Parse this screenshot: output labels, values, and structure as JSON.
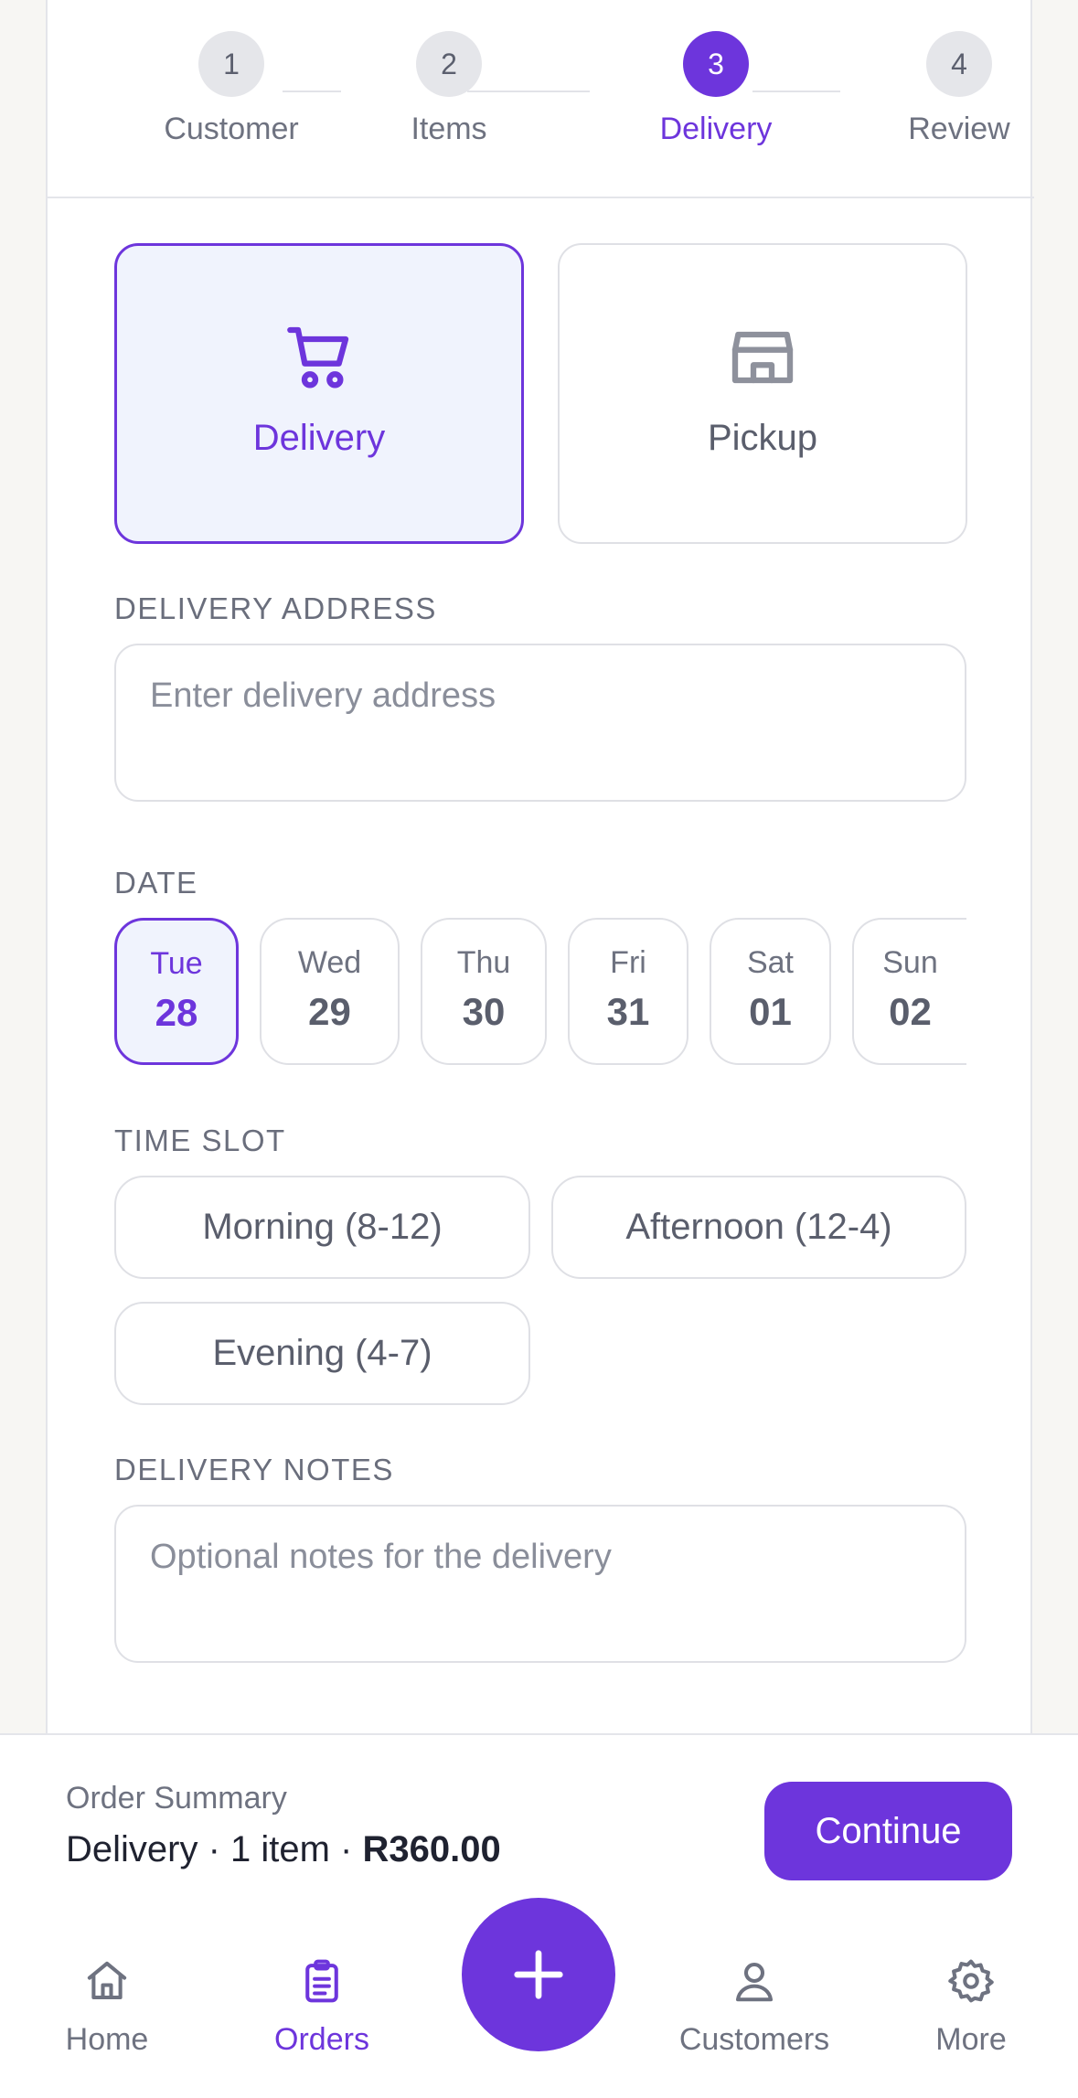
{
  "stepper": {
    "steps": [
      {
        "number": "1",
        "label": "Customer"
      },
      {
        "number": "2",
        "label": "Items"
      },
      {
        "number": "3",
        "label": "Delivery"
      },
      {
        "number": "4",
        "label": "Review"
      }
    ],
    "active_step": 3
  },
  "fulfillment": {
    "options": [
      {
        "label": "Delivery",
        "icon": "cart-icon",
        "selected": true
      },
      {
        "label": "Pickup",
        "icon": "store-icon",
        "selected": false
      }
    ]
  },
  "address": {
    "label": "DELIVERY ADDRESS",
    "placeholder": "Enter delivery address",
    "value": ""
  },
  "date": {
    "label": "DATE",
    "options": [
      {
        "dow": "Tue",
        "dom": "28",
        "selected": true
      },
      {
        "dow": "Wed",
        "dom": "29",
        "selected": false
      },
      {
        "dow": "Thu",
        "dom": "30",
        "selected": false
      },
      {
        "dow": "Fri",
        "dom": "31",
        "selected": false
      },
      {
        "dow": "Sat",
        "dom": "01",
        "selected": false
      },
      {
        "dow": "Sun",
        "dom": "02",
        "selected": false
      }
    ]
  },
  "time_slot": {
    "label": "TIME SLOT",
    "options": [
      "Morning (8-12)",
      "Afternoon (12-4)",
      "Evening (4-7)"
    ]
  },
  "notes": {
    "label": "DELIVERY NOTES",
    "placeholder": "Optional notes for the delivery",
    "value": ""
  },
  "summary": {
    "title": "Order Summary",
    "line_prefix": "Delivery · 1 item · ",
    "total": "R360.00",
    "continue_label": "Continue"
  },
  "tabbar": {
    "items": [
      {
        "label": "Home",
        "icon": "home-icon",
        "active": false
      },
      {
        "label": "Orders",
        "icon": "clipboard-icon",
        "active": true
      },
      {
        "label": "Customers",
        "icon": "user-icon",
        "active": false
      },
      {
        "label": "More",
        "icon": "gear-icon",
        "active": false
      }
    ],
    "fab_icon": "plus-icon"
  },
  "colors": {
    "accent": "#6d35dc",
    "selected_bg": "#f0f3fd",
    "border": "#dfe0e5",
    "muted_text": "#6e7280"
  }
}
